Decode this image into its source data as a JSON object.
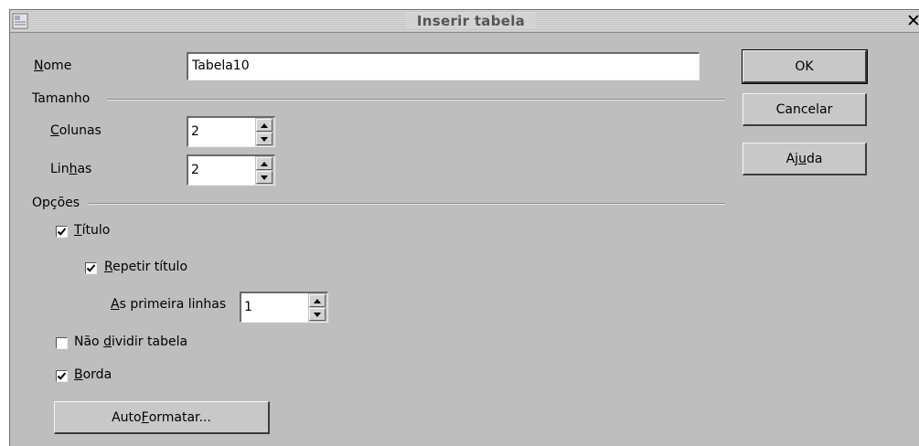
{
  "window": {
    "title": "Inserir tabela",
    "close_glyph": "✕"
  },
  "nome": {
    "label_u": "N",
    "label_rest": "ome",
    "value": "Tabela10"
  },
  "tamanho": {
    "section_label": "Tamanho",
    "colunas": {
      "label_u": "C",
      "label_rest": "olunas",
      "value": "2"
    },
    "linhas": {
      "label_pre": "Lin",
      "label_u": "h",
      "label_rest": "as",
      "value": "2"
    }
  },
  "opcoes": {
    "section_label": "Opções",
    "titulo": {
      "label_u": "T",
      "label_rest": "ítulo",
      "checked": true
    },
    "repetir_titulo": {
      "label_u": "R",
      "label_rest": "epetir título",
      "checked": true
    },
    "primeira_linhas": {
      "label_u": "A",
      "label_rest": "s primeira linhas",
      "value": "1"
    },
    "nao_dividir": {
      "label_pre": "Não ",
      "label_u": "d",
      "label_rest": "ividir tabela",
      "checked": false
    },
    "borda": {
      "label_u": "B",
      "label_rest": "orda",
      "checked": true
    },
    "autoformatar": {
      "label_pre": "Auto",
      "label_u": "F",
      "label_rest": "ormatar..."
    }
  },
  "buttons": {
    "ok": "OK",
    "cancelar": "Cancelar",
    "ajuda_pre": "Aj",
    "ajuda_u": "u",
    "ajuda_rest": "da"
  }
}
